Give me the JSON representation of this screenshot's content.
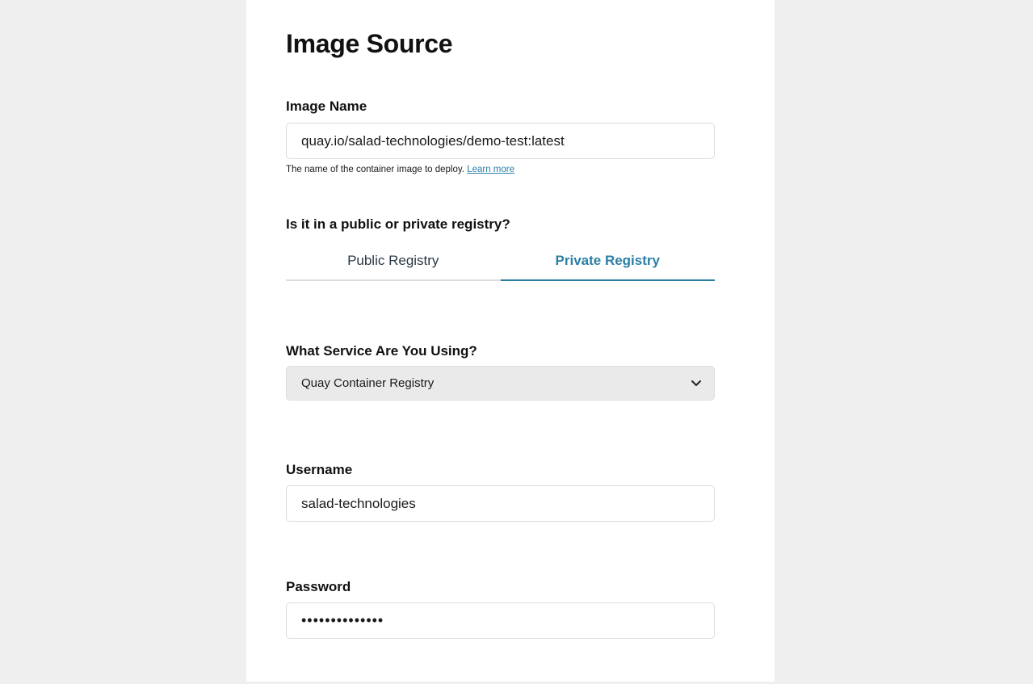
{
  "section": {
    "title": "Image Source"
  },
  "image_name": {
    "label": "Image Name",
    "value": "quay.io/salad-technologies/demo-test:latest",
    "helper_text": "The name of the container image to deploy.",
    "learn_more": "Learn more"
  },
  "registry": {
    "question": "Is it in a public or private registry?",
    "tabs": [
      {
        "label": "Public Registry",
        "active": false
      },
      {
        "label": "Private Registry",
        "active": true
      }
    ]
  },
  "service": {
    "label": "What Service Are You Using?",
    "selected": "Quay Container Registry",
    "icon": "chevron-down-icon"
  },
  "username": {
    "label": "Username",
    "value": "salad-technologies"
  },
  "password": {
    "label": "Password",
    "value": "••••••••••••••"
  },
  "colors": {
    "background": "#efefef",
    "panel": "#ffffff",
    "accent": "#2a7fa6",
    "select_bg": "#eaeaea"
  }
}
